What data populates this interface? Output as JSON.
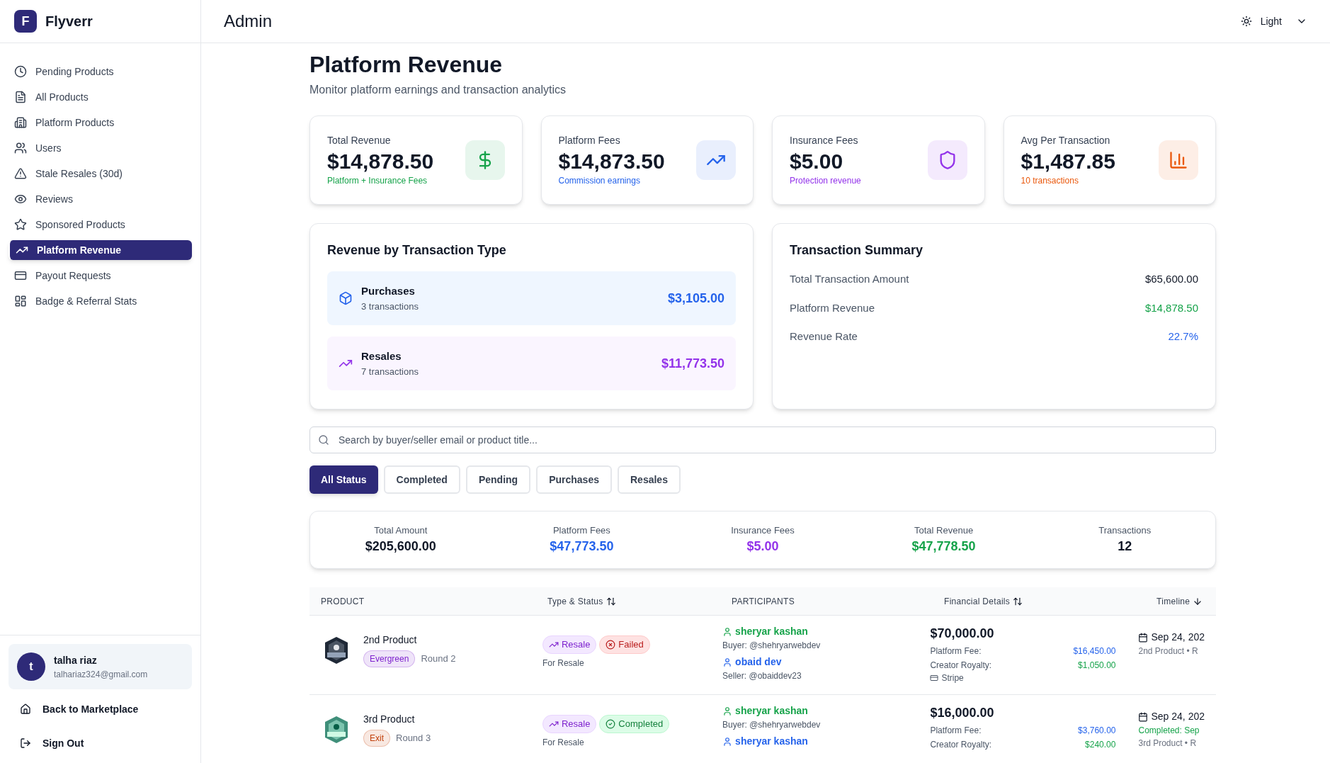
{
  "brand": {
    "logo_letter": "F",
    "name": "Flyverr"
  },
  "header": {
    "title": "Admin",
    "theme": "Light"
  },
  "sidebar": {
    "items": [
      {
        "label": "Pending Products",
        "selected": false
      },
      {
        "label": "All Products",
        "selected": false
      },
      {
        "label": "Platform Products",
        "selected": false
      },
      {
        "label": "Users",
        "selected": false
      },
      {
        "label": "Stale Resales (30d)",
        "selected": false
      },
      {
        "label": "Reviews",
        "selected": false
      },
      {
        "label": "Sponsored Products",
        "selected": false
      },
      {
        "label": "Platform Revenue",
        "selected": true
      },
      {
        "label": "Payout Requests",
        "selected": false
      },
      {
        "label": "Badge & Referral Stats",
        "selected": false
      }
    ],
    "user": {
      "initial": "t",
      "name": "talha riaz",
      "email": "talhariaz324@gmail.com"
    },
    "footer_links": [
      "Back to Marketplace",
      "Sign Out"
    ]
  },
  "page": {
    "title": "Platform Revenue",
    "subtitle": "Monitor platform earnings and transaction analytics"
  },
  "stat_cards": [
    {
      "label": "Total Revenue",
      "value": "$14,878.50",
      "note": "Platform + Insurance Fees",
      "color": "#16a34a"
    },
    {
      "label": "Platform Fees",
      "value": "$14,873.50",
      "note": "Commission earnings",
      "color": "#2563eb"
    },
    {
      "label": "Insurance Fees",
      "value": "$5.00",
      "note": "Protection revenue",
      "color": "#9333ea"
    },
    {
      "label": "Avg Per Transaction",
      "value": "$1,487.85",
      "note": "10 transactions",
      "color": "#ea580c"
    }
  ],
  "revenue_by_type": {
    "title": "Revenue by Transaction Type",
    "items": [
      {
        "kind": "purchase",
        "name": "Purchases",
        "count": "3 transactions",
        "amount": "$3,105.00"
      },
      {
        "kind": "resale",
        "name": "Resales",
        "count": "7 transactions",
        "amount": "$11,773.50"
      }
    ]
  },
  "transaction_summary": {
    "title": "Transaction Summary",
    "rows": [
      {
        "label": "Total Transaction Amount",
        "value": "$65,600.00",
        "color": "#111827"
      },
      {
        "label": "Platform Revenue",
        "value": "$14,878.50",
        "color": "#16a34a"
      },
      {
        "label": "Revenue Rate",
        "value": "22.7%",
        "color": "#2563eb"
      }
    ]
  },
  "search": {
    "placeholder": "Search by buyer/seller email or product title..."
  },
  "filters": [
    {
      "label": "All Status",
      "selected": true
    },
    {
      "label": "Completed",
      "selected": false
    },
    {
      "label": "Pending",
      "selected": false
    },
    {
      "label": "Purchases",
      "selected": false
    },
    {
      "label": "Resales",
      "selected": false
    }
  ],
  "totals": [
    {
      "label": "Total Amount",
      "value": "$205,600.00",
      "color": "#111827"
    },
    {
      "label": "Platform Fees",
      "value": "$47,773.50",
      "color": "#2563eb"
    },
    {
      "label": "Insurance Fees",
      "value": "$5.00",
      "color": "#9333ea"
    },
    {
      "label": "Total Revenue",
      "value": "$47,778.50",
      "color": "#16a34a"
    },
    {
      "label": "Transactions",
      "value": "12",
      "color": "#111827"
    }
  ],
  "table": {
    "columns": [
      "PRODUCT",
      "Type & Status",
      "PARTICIPANTS",
      "Financial Details",
      "Timeline"
    ],
    "rows": [
      {
        "product": "2nd Product",
        "tag": {
          "label": "Evergreen",
          "color": "#7e22ce"
        },
        "round": "Round 2",
        "type": "Resale",
        "status": {
          "label": "Failed",
          "kind": "failed"
        },
        "type_note": "For Resale",
        "buyer": "sheryar kashan",
        "buyer_handle": "Buyer: @shehryarwebdev",
        "seller": "obaid dev",
        "seller_handle": "Seller: @obaiddev23",
        "amount": "$70,000.00",
        "fees": [
          {
            "label": "Platform Fee:",
            "value": "$16,450.00",
            "color": "#2563eb"
          },
          {
            "label": "Creator Royalty:",
            "value": "$1,050.00",
            "color": "#16a34a"
          }
        ],
        "method": "Stripe",
        "date": "Sep 24, 202",
        "timeline_lines": [
          {
            "text": "2nd Product • R",
            "color": "#6b7280"
          }
        ]
      },
      {
        "product": "3rd Product",
        "tag": {
          "label": "Exit",
          "color": "#c2410c"
        },
        "round": "Round 3",
        "type": "Resale",
        "status": {
          "label": "Completed",
          "kind": "completed"
        },
        "type_note": "For Resale",
        "buyer": "sheryar kashan",
        "buyer_handle": "Buyer: @shehryarwebdev",
        "seller": "sheryar kashan",
        "amount": "$16,000.00",
        "fees": [
          {
            "label": "Platform Fee:",
            "value": "$3,760.00",
            "color": "#2563eb"
          },
          {
            "label": "Creator Royalty:",
            "value": "$240.00",
            "color": "#16a34a"
          }
        ],
        "date": "Sep 24, 202",
        "timeline_lines": [
          {
            "text": "Completed: Sep",
            "color": "#16a34a"
          },
          {
            "text": "3rd Product • R",
            "color": "#6b7280"
          }
        ]
      }
    ]
  }
}
